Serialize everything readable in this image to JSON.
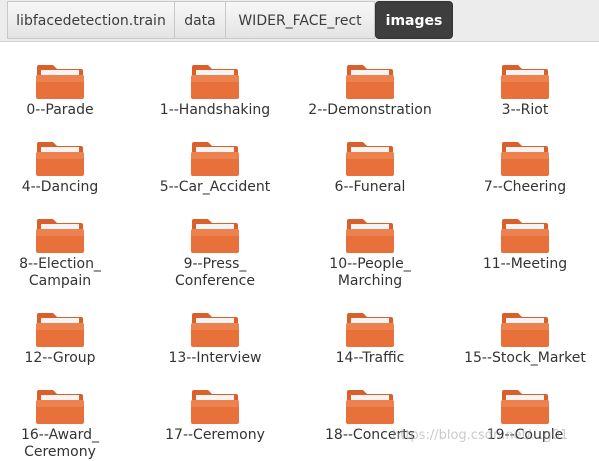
{
  "breadcrumb": [
    {
      "label": "libfacedetection.train"
    },
    {
      "label": "data"
    },
    {
      "label": "WIDER_FACE_rect"
    },
    {
      "label": "images"
    }
  ],
  "folders": [
    {
      "label": "0--Parade"
    },
    {
      "label": "1--Handshaking"
    },
    {
      "label": "2--Demonstration"
    },
    {
      "label": "3--Riot"
    },
    {
      "label": "4--Dancing"
    },
    {
      "label": "5--Car_Accident"
    },
    {
      "label": "6--Funeral"
    },
    {
      "label": "7--Cheering"
    },
    {
      "label": "8--Election_\nCampain"
    },
    {
      "label": "9--Press_\nConference"
    },
    {
      "label": "10--People_\nMarching"
    },
    {
      "label": "11--Meeting"
    },
    {
      "label": "12--Group"
    },
    {
      "label": "13--Interview"
    },
    {
      "label": "14--Traffic"
    },
    {
      "label": "15--Stock_Market"
    },
    {
      "label": "16--Award_\nCeremony"
    },
    {
      "label": "17--Ceremony"
    },
    {
      "label": "18--Concerts"
    },
    {
      "label": "19--Couple"
    }
  ],
  "watermark": "https://blog.csdn.net/...g01",
  "colors": {
    "folder_body": "#e8703a",
    "folder_tab": "#d9602a",
    "folder_paper": "#f4f4f4",
    "active_crumb": "#3e3e3e"
  },
  "icons": {
    "folder": "folder-icon"
  }
}
